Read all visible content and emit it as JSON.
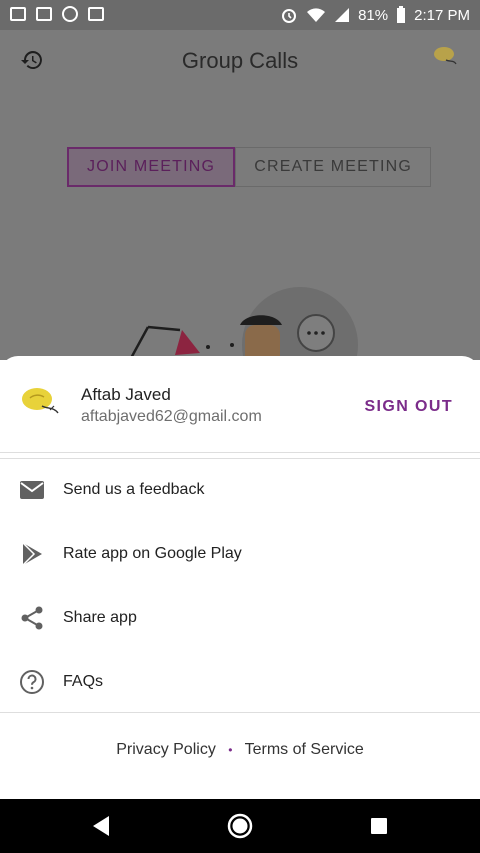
{
  "status_bar": {
    "battery": "81%",
    "time": "2:17 PM"
  },
  "background_app": {
    "title": "Group Calls",
    "tabs": [
      {
        "label": "JOIN MEETING",
        "active": true
      },
      {
        "label": "CREATE MEETING",
        "active": false
      }
    ]
  },
  "sheet": {
    "user": {
      "name": "Aftab Javed",
      "email": "aftabjaved62@gmail.com"
    },
    "sign_out_label": "SIGN OUT",
    "menu": [
      {
        "label": "Send us a feedback",
        "icon": "mail-icon"
      },
      {
        "label": "Rate app on Google Play",
        "icon": "play-store-icon"
      },
      {
        "label": "Share app",
        "icon": "share-icon"
      },
      {
        "label": "FAQs",
        "icon": "help-icon"
      }
    ],
    "footer": {
      "privacy": "Privacy Policy",
      "separator": "•",
      "terms": "Terms of Service"
    }
  },
  "colors": {
    "accent": "#7b2c8a",
    "scrim": "#7b7b7b"
  }
}
